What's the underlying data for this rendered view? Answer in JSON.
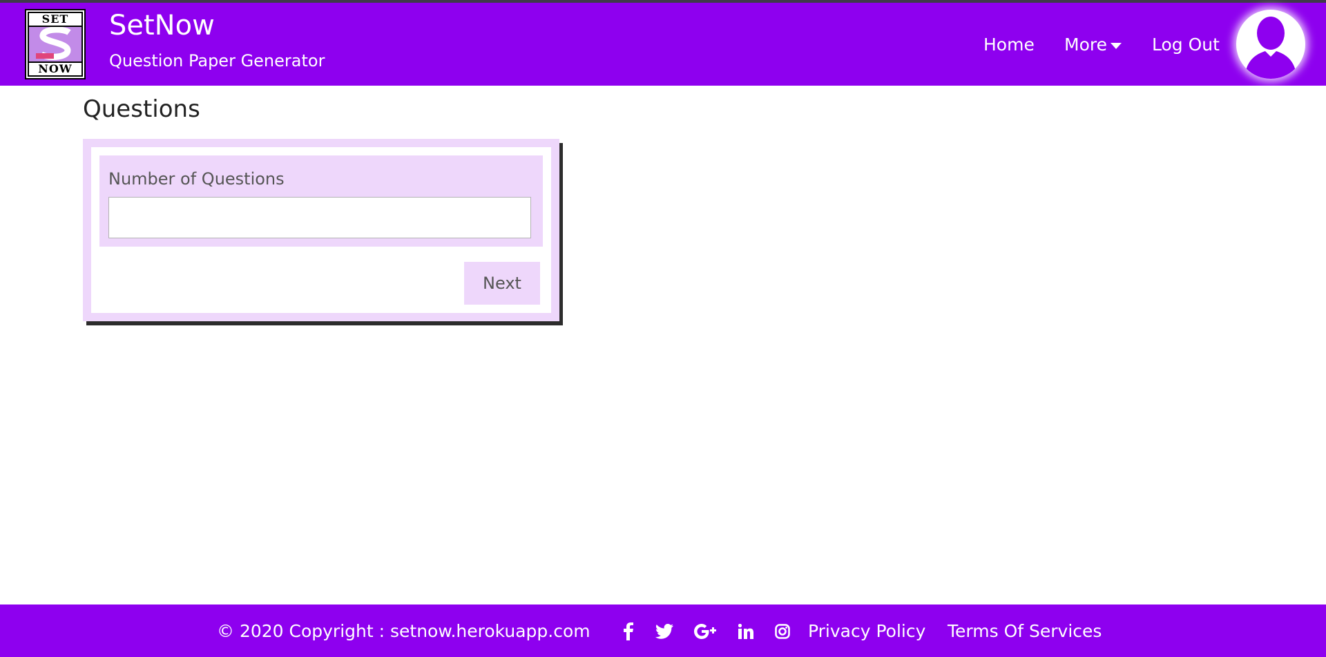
{
  "header": {
    "brand_title": "SetNow",
    "brand_subtitle": "Question Paper Generator",
    "logo_text_top": "SET",
    "logo_text_bottom": "NOW",
    "nav": {
      "home": "Home",
      "more": "More",
      "logout": "Log Out"
    }
  },
  "main": {
    "page_title": "Questions",
    "form": {
      "label": "Number of Questions",
      "input_value": "",
      "input_placeholder": "",
      "next_label": "Next"
    }
  },
  "footer": {
    "copyright": "© 2020 Copyright :   setnow.herokuapp.com",
    "social_icons": [
      "facebook-icon",
      "twitter-icon",
      "google-plus-icon",
      "linkedin-icon",
      "instagram-icon"
    ],
    "privacy": "Privacy Policy",
    "terms": "Terms Of Services"
  },
  "colors": {
    "primary": "#8e00ef",
    "panel": "#eed7fb",
    "logo_pink": "#e0457b"
  }
}
